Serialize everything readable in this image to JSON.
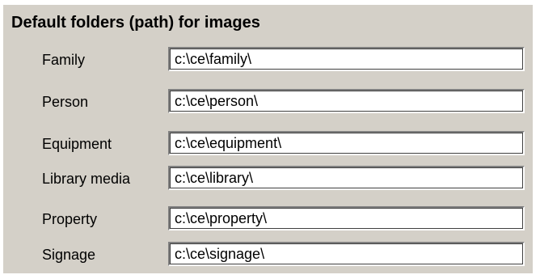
{
  "section": {
    "title": "Default folders (path) for images"
  },
  "folders": [
    {
      "label": "Family",
      "value": "c:\\ce\\family\\"
    },
    {
      "label": "Person",
      "value": "c:\\ce\\person\\"
    },
    {
      "label": "Equipment",
      "value": "c:\\ce\\equipment\\"
    },
    {
      "label": "Library media",
      "value": "c:\\ce\\library\\"
    },
    {
      "label": "Property",
      "value": "c:\\ce\\property\\"
    },
    {
      "label": "Signage",
      "value": "c:\\ce\\signage\\"
    }
  ]
}
